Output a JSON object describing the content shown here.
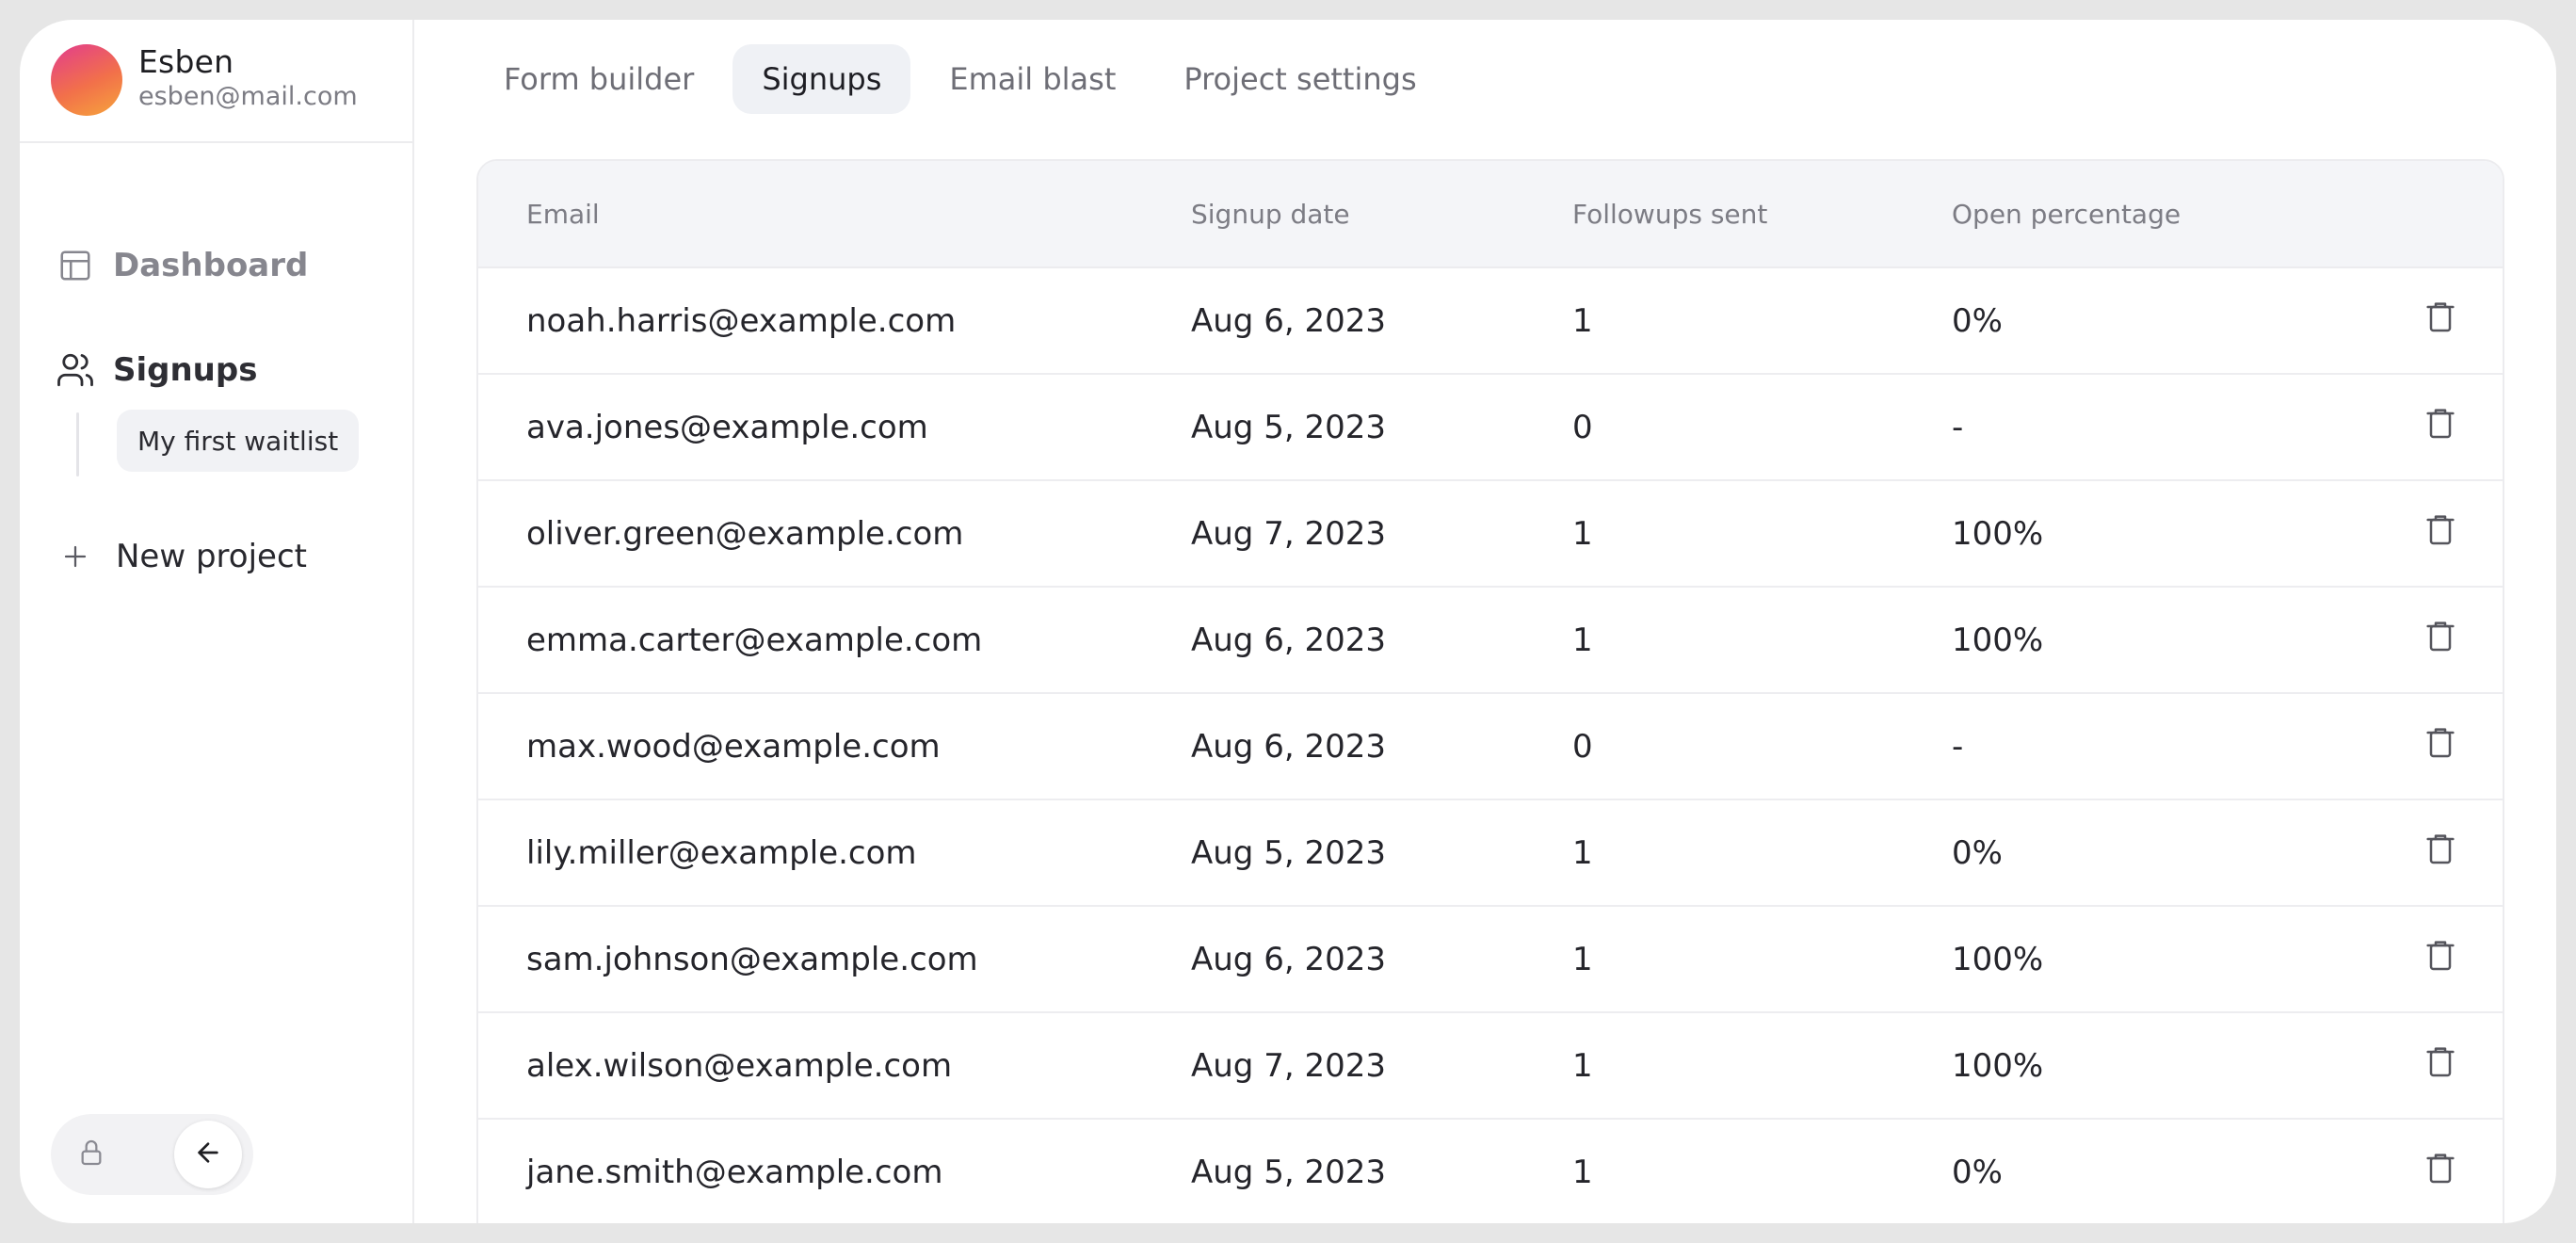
{
  "profile": {
    "name": "Esben",
    "email": "esben@mail.com"
  },
  "sidebar": {
    "items": [
      {
        "label": "Dashboard",
        "icon": "layout-icon"
      },
      {
        "label": "Signups",
        "icon": "users-icon"
      }
    ],
    "subitem": "My first waitlist",
    "new_project": "New project",
    "bottom": {
      "lock_icon": "lock-icon",
      "back_icon": "arrow-left-icon"
    }
  },
  "tabs": [
    {
      "label": "Form builder",
      "active": false
    },
    {
      "label": "Signups",
      "active": true
    },
    {
      "label": "Email blast",
      "active": false
    },
    {
      "label": "Project settings",
      "active": false
    }
  ],
  "table": {
    "headers": [
      "Email",
      "Signup date",
      "Followups sent",
      "Open percentage"
    ],
    "rows": [
      {
        "email": "noah.harris@example.com",
        "date": "Aug 6, 2023",
        "followups": "1",
        "open": "0%"
      },
      {
        "email": "ava.jones@example.com",
        "date": "Aug 5, 2023",
        "followups": "0",
        "open": "-"
      },
      {
        "email": "oliver.green@example.com",
        "date": "Aug 7, 2023",
        "followups": "1",
        "open": "100%"
      },
      {
        "email": "emma.carter@example.com",
        "date": "Aug 6, 2023",
        "followups": "1",
        "open": "100%"
      },
      {
        "email": "max.wood@example.com",
        "date": "Aug 6, 2023",
        "followups": "0",
        "open": "-"
      },
      {
        "email": "lily.miller@example.com",
        "date": "Aug 5, 2023",
        "followups": "1",
        "open": "0%"
      },
      {
        "email": "sam.johnson@example.com",
        "date": "Aug 6, 2023",
        "followups": "1",
        "open": "100%"
      },
      {
        "email": "alex.wilson@example.com",
        "date": "Aug 7, 2023",
        "followups": "1",
        "open": "100%"
      },
      {
        "email": "jane.smith@example.com",
        "date": "Aug 5, 2023",
        "followups": "1",
        "open": "0%"
      }
    ],
    "row_action_icon": "trash-icon"
  },
  "colors": {
    "background": "#e6e6e6",
    "panel": "#ffffff",
    "active_tab": "#eff1f5",
    "header_row": "#f4f5f8",
    "text_primary": "#25252b",
    "text_muted": "#7c7c84"
  }
}
